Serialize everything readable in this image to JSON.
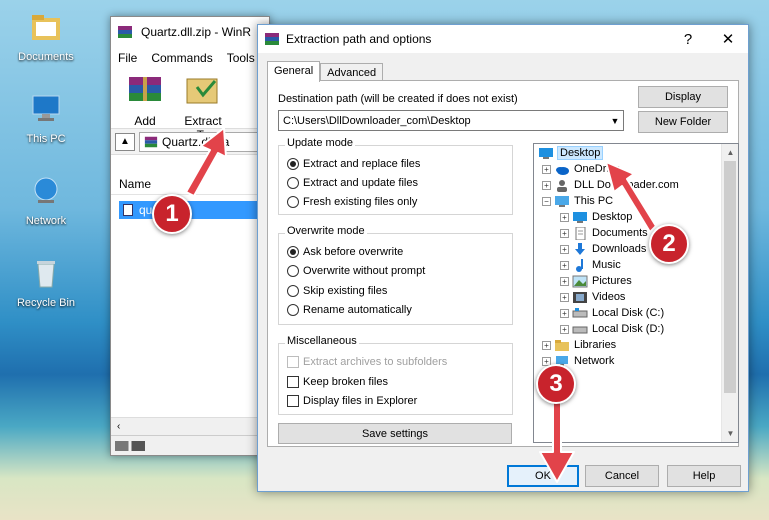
{
  "desktop": {
    "icons": [
      {
        "label": "Documents"
      },
      {
        "label": "This PC"
      },
      {
        "label": "Network"
      },
      {
        "label": "Recycle Bin"
      }
    ]
  },
  "winrar": {
    "title": "Quartz.dll.zip - WinR",
    "menu": [
      "File",
      "Commands",
      "Tools"
    ],
    "toolbar": {
      "add_label": "Add",
      "extract_label": "Extract To"
    },
    "path": "Quartz.dll.za",
    "list_header": "Name",
    "list_item": "quartz.dll"
  },
  "dialog": {
    "title": "Extraction path and options",
    "help_glyph": "?",
    "close_glyph": "✕",
    "tabs": [
      "General",
      "Advanced"
    ],
    "dest_label": "Destination path (will be created if does not exist)",
    "dest_value": "C:\\Users\\DllDownloader_com\\Desktop",
    "display_label": "Display",
    "new_folder_label": "New Folder",
    "update_mode": {
      "title": "Update mode",
      "options": [
        "Extract and replace files",
        "Extract and update files",
        "Fresh existing files only"
      ],
      "selected": 0
    },
    "overwrite_mode": {
      "title": "Overwrite mode",
      "options": [
        "Ask before overwrite",
        "Overwrite without prompt",
        "Skip existing files",
        "Rename automatically"
      ],
      "selected": 0
    },
    "misc": {
      "title": "Miscellaneous",
      "options": [
        "Extract archives to subfolders",
        "Keep broken files",
        "Display files in Explorer"
      ]
    },
    "save_settings_label": "Save settings",
    "tree": [
      {
        "label": "Desktop",
        "icon": "desktop-icon"
      },
      {
        "label": "OneDrive",
        "icon": "cloud-icon"
      },
      {
        "label": "DLL Downloader.com",
        "icon": "user-icon"
      },
      {
        "label": "This PC",
        "icon": "computer-icon"
      },
      {
        "label": "Desktop",
        "icon": "desktop-icon"
      },
      {
        "label": "Documents",
        "icon": "document-icon"
      },
      {
        "label": "Downloads",
        "icon": "download-icon"
      },
      {
        "label": "Music",
        "icon": "music-icon"
      },
      {
        "label": "Pictures",
        "icon": "picture-icon"
      },
      {
        "label": "Videos",
        "icon": "video-icon"
      },
      {
        "label": "Local Disk (C:)",
        "icon": "drive-icon"
      },
      {
        "label": "Local Disk (D:)",
        "icon": "drive-icon"
      },
      {
        "label": "Libraries",
        "icon": "folder-icon"
      },
      {
        "label": "Network",
        "icon": "network-icon"
      }
    ],
    "ok_label": "OK",
    "cancel_label": "Cancel",
    "help_label": "Help"
  },
  "annotations": {
    "step1": "1",
    "step2": "2",
    "step3": "3"
  },
  "colors": {
    "badge": "#c8232c",
    "selection": "#3399ff",
    "accent": "#0078d7"
  }
}
